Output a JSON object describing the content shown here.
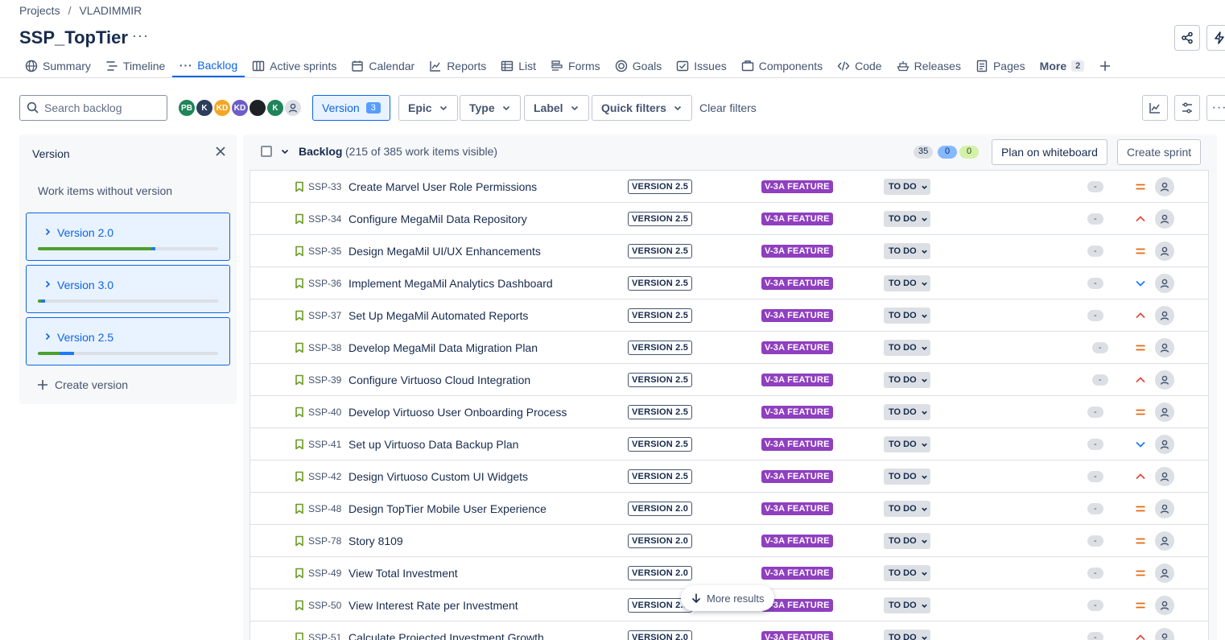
{
  "breadcrumb": {
    "root": "Projects",
    "separator": "/",
    "project": "VLADIMMIR"
  },
  "title": "SSP_TopTier",
  "tabs": [
    {
      "label": "Summary",
      "icon": "globe-icon"
    },
    {
      "label": "Timeline",
      "icon": "timeline-icon"
    },
    {
      "label": "Backlog",
      "icon": "backlog-icon",
      "active": true
    },
    {
      "label": "Active sprints",
      "icon": "board-icon"
    },
    {
      "label": "Calendar",
      "icon": "calendar-icon"
    },
    {
      "label": "Reports",
      "icon": "chart-icon"
    },
    {
      "label": "List",
      "icon": "list-icon"
    },
    {
      "label": "Forms",
      "icon": "forms-icon"
    },
    {
      "label": "Goals",
      "icon": "goal-icon"
    },
    {
      "label": "Issues",
      "icon": "issues-icon"
    },
    {
      "label": "Components",
      "icon": "components-icon"
    },
    {
      "label": "Code",
      "icon": "code-icon"
    },
    {
      "label": "Releases",
      "icon": "ship-icon"
    },
    {
      "label": "Pages",
      "icon": "page-icon"
    }
  ],
  "more_tab": {
    "label": "More",
    "count": "2"
  },
  "toolbar": {
    "search_placeholder": "Search backlog",
    "avatars": [
      {
        "initials": "PB",
        "color": "#1f845a"
      },
      {
        "initials": "K",
        "color": "#2c3e5d"
      },
      {
        "initials": "KD",
        "color": "#f5a623"
      },
      {
        "initials": "KD",
        "color": "#6e5dc6"
      },
      {
        "initials": "",
        "color": "#1d2125"
      },
      {
        "initials": "K",
        "color": "#1f845a"
      },
      {
        "initials": "",
        "color": "#dcdfe4"
      }
    ],
    "version_label": "Version",
    "version_count": "3",
    "epic_label": "Epic",
    "type_label": "Type",
    "label_label": "Label",
    "quick_filters_label": "Quick filters",
    "clear_filters": "Clear filters"
  },
  "version_panel": {
    "title": "Version",
    "no_version": "Work items without version",
    "versions": [
      {
        "name": "Version 2.0",
        "done": 0.63,
        "progress": 0.02
      },
      {
        "name": "Version 3.0",
        "done": 0.02,
        "progress": 0.02
      },
      {
        "name": "Version 2.5",
        "done": 0.12,
        "progress": 0.08
      }
    ],
    "create": "Create version"
  },
  "backlog": {
    "title": "Backlog",
    "count": "(215 of 385 work items visible)",
    "sum_todo": "35",
    "sum_progress": "0",
    "sum_done": "0",
    "plan_button": "Plan on whiteboard",
    "create_sprint": "Create sprint"
  },
  "rows": [
    {
      "key": "SSP-33",
      "summary": "Create Marvel User Role Permissions",
      "version": "VERSION 2.5",
      "epic": "V-3A FEATURE",
      "status": "TO DO",
      "estimate": "-",
      "priority": "medium"
    },
    {
      "key": "SSP-34",
      "summary": "Configure MegaMil Data Repository",
      "version": "VERSION 2.5",
      "epic": "V-3A FEATURE",
      "status": "TO DO",
      "estimate": "-",
      "priority": "high"
    },
    {
      "key": "SSP-35",
      "summary": "Design MegaMil UI/UX Enhancements",
      "version": "VERSION 2.5",
      "epic": "V-3A FEATURE",
      "status": "TO DO",
      "estimate": "-",
      "priority": "medium"
    },
    {
      "key": "SSP-36",
      "summary": "Implement MegaMil Analytics Dashboard",
      "version": "VERSION 2.5",
      "epic": "V-3A FEATURE",
      "status": "TO DO",
      "estimate": "-",
      "priority": "low"
    },
    {
      "key": "SSP-37",
      "summary": "Set Up MegaMil Automated Reports",
      "version": "VERSION 2.5",
      "epic": "V-3A FEATURE",
      "status": "TO DO",
      "estimate": "-",
      "priority": "high"
    },
    {
      "key": "SSP-38",
      "summary": "Develop MegaMil Data Migration Plan",
      "version": "VERSION 2.5",
      "epic": "V-3A FEATURE",
      "status": "TO DO",
      "estimate": "-",
      "priority": "medium"
    },
    {
      "key": "SSP-39",
      "summary": "Configure Virtuoso Cloud Integration",
      "version": "VERSION 2.5",
      "epic": "V-3A FEATURE",
      "status": "TO DO",
      "estimate": "-",
      "priority": "high"
    },
    {
      "key": "SSP-40",
      "summary": "Develop Virtuoso User Onboarding Process",
      "version": "VERSION 2.5",
      "epic": "V-3A FEATURE",
      "status": "TO DO",
      "estimate": "-",
      "priority": "medium"
    },
    {
      "key": "SSP-41",
      "summary": "Set up Virtuoso Data Backup Plan",
      "version": "VERSION 2.5",
      "epic": "V-3A FEATURE",
      "status": "TO DO",
      "estimate": "-",
      "priority": "low"
    },
    {
      "key": "SSP-42",
      "summary": "Design Virtuoso Custom UI Widgets",
      "version": "VERSION 2.5",
      "epic": "V-3A FEATURE",
      "status": "TO DO",
      "estimate": "-",
      "priority": "high"
    },
    {
      "key": "SSP-48",
      "summary": "Design TopTier Mobile User Experience",
      "version": "VERSION 2.0",
      "epic": "V-3A FEATURE",
      "status": "TO DO",
      "estimate": "-",
      "priority": "medium"
    },
    {
      "key": "SSP-78",
      "summary": "Story 8109",
      "version": "VERSION 2.0",
      "epic": "V-3A FEATURE",
      "status": "TO DO",
      "estimate": "-",
      "priority": "medium"
    },
    {
      "key": "SSP-49",
      "summary": "View Total Investment",
      "version": "VERSION 2.0",
      "epic": "V-3A FEATURE",
      "status": "TO DO",
      "estimate": "-",
      "priority": "medium"
    },
    {
      "key": "SSP-50",
      "summary": "View Interest Rate per Investment",
      "version": "VERSION 2.0",
      "epic": "V-3A FEATURE",
      "status": "TO DO",
      "estimate": "-",
      "priority": "medium"
    },
    {
      "key": "SSP-51",
      "summary": "Calculate Projected Investment Growth",
      "version": "VERSION 2.0",
      "epic": "V-3A FEATURE",
      "status": "TO DO",
      "estimate": "-",
      "priority": "high"
    }
  ],
  "more_results": "More results"
}
